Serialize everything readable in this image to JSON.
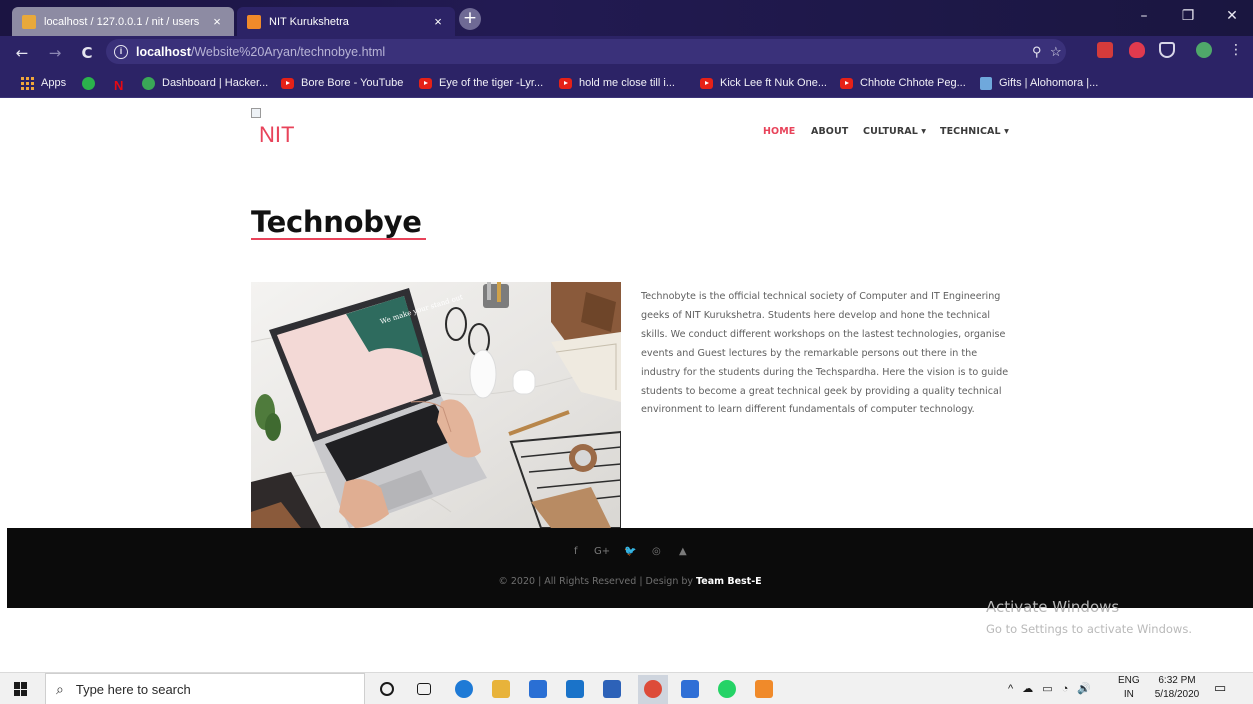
{
  "browser": {
    "tabs": [
      {
        "title": "localhost / 127.0.0.1 / nit / users",
        "active": false
      },
      {
        "title": "NIT Kurukshetra",
        "active": true
      }
    ],
    "close_glyph": "×",
    "new_tab_glyph": "+",
    "window_controls": {
      "minimize": "–",
      "maximize": "❐",
      "close": "✕"
    },
    "url": {
      "host": "localhost",
      "path": "/Website%20Aryan/technobye.html"
    },
    "bookmarks": [
      {
        "label": "Apps",
        "icon": "apps-grid-icon"
      },
      {
        "label": "",
        "icon": "green-play-icon"
      },
      {
        "label": "",
        "icon": "netflix-icon"
      },
      {
        "label": "Dashboard | Hacker...",
        "icon": "hackerearth-icon"
      },
      {
        "label": "Bore Bore - YouTube",
        "icon": "youtube-icon"
      },
      {
        "label": "Eye of the tiger -Lyr...",
        "icon": "youtube-icon"
      },
      {
        "label": "hold me close till i...",
        "icon": "youtube-icon"
      },
      {
        "label": "Kick Lee ft Nuk One...",
        "icon": "youtube-icon"
      },
      {
        "label": "Chhote Chhote Peg...",
        "icon": "youtube-icon"
      },
      {
        "label": "Gifts | Alohomora |...",
        "icon": "calendar-icon"
      }
    ]
  },
  "site": {
    "logo_alt": "NIT",
    "nav": [
      {
        "label": "HOME",
        "active": true
      },
      {
        "label": "ABOUT",
        "active": false
      },
      {
        "label": "CULTURAL ▾",
        "active": false
      },
      {
        "label": "TECHNICAL ▾",
        "active": false
      }
    ],
    "heading": "Technobye",
    "description": "Technobyte is the official technical society of Computer and IT Engineering geeks of NIT Kurukshetra. Students here develop and hone the technical skills. We conduct different workshops on the lastest technologies, organise events and Guest lectures by the remarkable persons out there in the industry for the students during the Techspardha. Here the vision is to guide students to become a great technical geek by providing a quality technical environment to learn different fundamentals of computer technology.",
    "photo_note": "We make your stand out",
    "footer": {
      "social": [
        "f",
        "G+",
        "🐦",
        "◎",
        "▲"
      ],
      "copyright_prefix": "© 2020 | All Rights Reserved | Design by",
      "team": "Team Best-E"
    }
  },
  "windows": {
    "activate_title": "Activate Windows",
    "activate_sub": "Go to Settings to activate Windows.",
    "search_placeholder": "Type here to search",
    "tray_lang": "ENG",
    "tray_region": "IN",
    "time": "6:32 PM",
    "date": "5/18/2020",
    "tray_glyphs": "^ ☁ ▭ ◔ 🔊"
  },
  "colors": {
    "accent": "#e8435a",
    "chrome": "#2c2366",
    "footer": "#0b0b0b"
  }
}
